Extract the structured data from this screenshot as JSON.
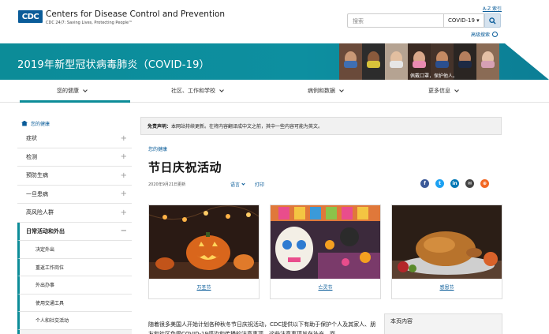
{
  "header": {
    "logo": "CDC",
    "org_name": "Centers for Disease Control and Prevention",
    "tagline": "CDC 24/7: Saving Lives, Protecting People™",
    "az_index": "A-Z 索引",
    "search_placeholder": "搜索",
    "search_scope": "COVID-19 ▾",
    "advanced_search": "高级搜索"
  },
  "banner": {
    "title": "2019年新型冠状病毒肺炎（COVID-19）",
    "mask_caption": "佩戴口罩，保护他人。"
  },
  "nav": {
    "items": [
      {
        "label": "您的健康"
      },
      {
        "label": "社区、工作和学校"
      },
      {
        "label": "病例和数据"
      },
      {
        "label": "更多信息"
      }
    ]
  },
  "sidebar": {
    "home": "您的健康",
    "items": [
      {
        "label": "症状",
        "expand": "+"
      },
      {
        "label": "检测",
        "expand": "+"
      },
      {
        "label": "预防生病",
        "expand": "+"
      },
      {
        "label": "一旦患病",
        "expand": "+"
      },
      {
        "label": "高风险人群",
        "expand": "+"
      },
      {
        "label": "日常活动和外出",
        "expand": "−"
      }
    ],
    "sub_items": [
      {
        "label": "决定外出"
      },
      {
        "label": "重返工作岗位"
      },
      {
        "label": "外出办事"
      },
      {
        "label": "使用交通工具"
      },
      {
        "label": "个人和社交活动"
      }
    ]
  },
  "main": {
    "disclaimer_bold": "免责声明：",
    "disclaimer_text": "本网站持续更新。在将内容翻译成中文之前，其中一些内容可能为英文。",
    "breadcrumb": "您的健康",
    "title": "节日庆祝活动",
    "meta_date": "2020年9月21日更新",
    "language": "语言",
    "print": "打印",
    "body_text": "随着很多美国人开始计划各种秋冬节日庆祝活动，CDC提供以下有助于保护个人及其家人、朋友和社区免受COVID-19感染和传播的注意事项。这些注意事项旨在补充—而",
    "toc_title": "本页内容"
  },
  "cards": [
    {
      "label": "万圣节"
    },
    {
      "label": "亡灵节"
    },
    {
      "label": "感恩节"
    }
  ],
  "social": [
    {
      "name": "facebook-icon",
      "glyph": "f",
      "color": "#3b5998"
    },
    {
      "name": "twitter-icon",
      "glyph": "t",
      "color": "#1da1f2"
    },
    {
      "name": "linkedin-icon",
      "glyph": "in",
      "color": "#0077b5"
    },
    {
      "name": "email-icon",
      "glyph": "✉",
      "color": "#444444"
    },
    {
      "name": "syndicate-icon",
      "glyph": "⊕",
      "color": "#f26722"
    }
  ],
  "colors": {
    "brand_blue": "#0a5c99",
    "banner_teal": "#0c8c98"
  }
}
